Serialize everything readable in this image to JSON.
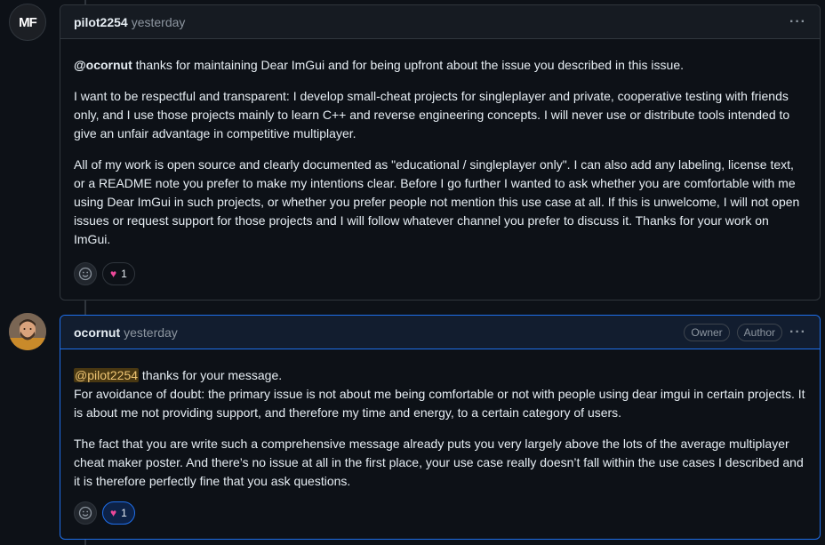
{
  "comments": [
    {
      "avatar_text": "MF",
      "author": "pilot2254",
      "time": "yesterday",
      "mention": "@ocornut",
      "p1_rest": " thanks for maintaining Dear ImGui and for being upfront about the issue you described in this issue.",
      "p2": "I want to be respectful and transparent: I develop small-cheat projects for singleplayer and private, cooperative testing with friends only, and I use those projects mainly to learn C++ and reverse engineering concepts. I will never use or distribute tools intended to give an unfair advantage in competitive multiplayer.",
      "p3": "All of my work is open source and clearly documented as \"educational / singleplayer only\". I can also add any labeling, license text, or a README note you prefer to make my intentions clear. Before I go further I wanted to ask whether you are comfortable with me using Dear ImGui in such projects, or whether you prefer people not mention this use case at all. If this is unwelcome, I will not open issues or request support for those projects and I will follow whatever channel you prefer to discuss it. Thanks for your work on ImGui.",
      "reaction_count": "1"
    },
    {
      "author": "ocornut",
      "time": "yesterday",
      "badge_owner": "Owner",
      "badge_author": "Author",
      "mention": "@pilot2254",
      "p1_rest": " thanks for your message.",
      "p1_line2": "For avoidance of doubt: the primary issue is not about me being comfortable or not with people using dear imgui in certain projects. It is about me not providing support, and therefore my time and energy, to a certain category of users.",
      "p2": "The fact that you are write such a comprehensive message already puts you very largely above the lots of the average multiplayer cheat maker poster. And there’s no issue at all in the first place, your use case really doesn’t fall within the use cases I described and it is therefore perfectly fine that you ask questions.",
      "reaction_count": "1"
    }
  ],
  "icons": {
    "more": "kebab-horizontal-icon",
    "smiley": "smiley-icon",
    "heart": "heart-icon"
  },
  "colors": {
    "background": "#0d1117",
    "border": "#30363d",
    "accent": "#1f6feb",
    "heart": "#ec4899"
  }
}
